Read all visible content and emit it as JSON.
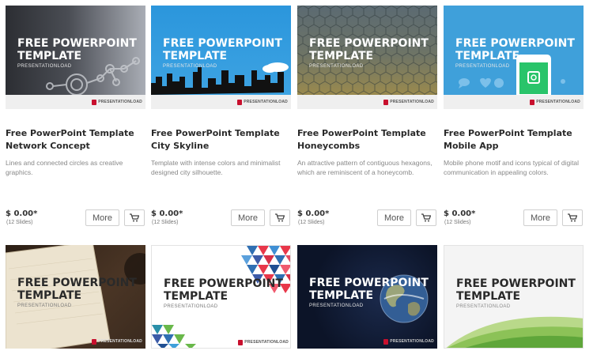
{
  "thumbnail": {
    "title_line1": "FREE POWERPOINT",
    "title_line2": "TEMPLATE",
    "subtitle": "PRESENTATIONLOAD",
    "logo_text": "PRESENTATIONLOAD"
  },
  "products": [
    {
      "title": "Free PowerPoint Template Network Concept",
      "description": "Lines and connected circles as creative graphics.",
      "price": "$ 0.00*",
      "slides": "(12 Slides)",
      "more_label": "More",
      "theme_colors": [
        "#2f3136",
        "#b8bcc4"
      ]
    },
    {
      "title": "Free PowerPoint Template City Skyline",
      "description": "Template with intense colors and minimalist designed city silhouette.",
      "price": "$ 0.00*",
      "slides": "(12 Slides)",
      "more_label": "More",
      "theme_colors": [
        "#2a8fd1",
        "#111111"
      ]
    },
    {
      "title": "Free PowerPoint Template Honeycombs",
      "description": "An attractive pattern of contiguous hexagons, which are reminiscent of a honeycomb.",
      "price": "$ 0.00*",
      "slides": "(12 Slides)",
      "more_label": "More",
      "theme_colors": [
        "#5d6a6e",
        "#a48f4a"
      ]
    },
    {
      "title": "Free PowerPoint Template Mobile App",
      "description": "Mobile phone motif and icons typical of digital communication in appealing colors.",
      "price": "$ 0.00*",
      "slides": "(12 Slides)",
      "more_label": "More",
      "theme_colors": [
        "#3fa0da",
        "#29c46a"
      ]
    }
  ],
  "second_row": [
    {
      "theme": "notebook",
      "theme_colors": [
        "#3a2a1e",
        "#ece3cf"
      ]
    },
    {
      "theme": "triangles",
      "theme_colors": [
        "#ffffff",
        "#2a6fb2"
      ]
    },
    {
      "theme": "earth",
      "theme_colors": [
        "#0f1830",
        "#6f93bd"
      ]
    },
    {
      "theme": "green-waves",
      "theme_colors": [
        "#f3f3f3",
        "#7ab34a"
      ]
    }
  ],
  "icons": {
    "cart": "shopping-cart-icon",
    "logo": "presentationload-logo-icon"
  }
}
